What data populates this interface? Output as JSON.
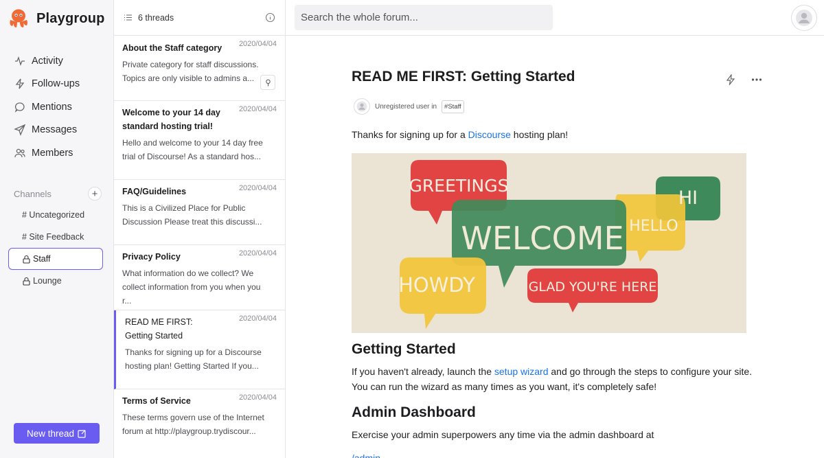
{
  "brand": {
    "name": "Playgroup",
    "logo_icon": "octopus-logo-icon",
    "logo_color": "#f06a35"
  },
  "nav": [
    {
      "label": "Activity",
      "icon": "activity-icon"
    },
    {
      "label": "Follow-ups",
      "icon": "lightning-icon"
    },
    {
      "label": "Mentions",
      "icon": "chat-bubble-icon"
    },
    {
      "label": "Messages",
      "icon": "send-icon"
    },
    {
      "label": "Members",
      "icon": "members-icon"
    }
  ],
  "channels": {
    "label": "Channels",
    "add_label": "+",
    "items": [
      {
        "label": "# Uncategorized",
        "locked": false
      },
      {
        "label": "# Site Feedback",
        "locked": false
      },
      {
        "label": "Staff",
        "locked": true,
        "active": true
      },
      {
        "label": "Lounge",
        "locked": true
      }
    ]
  },
  "new_thread": {
    "label": "New thread",
    "icon": "compose-icon"
  },
  "threads": {
    "count_label": "6 threads",
    "items": [
      {
        "title": "About the Staff category",
        "date": "2020/04/04",
        "excerpt": "Private category for staff discussions.\nTopics are only visible to admins a...",
        "pinned": true
      },
      {
        "title": "Welcome to your 14 day standard hosting trial!",
        "date": "2020/04/04",
        "excerpt": "Hello and welcome to your 14 day free\ntrial of Discourse! As a standard hos..."
      },
      {
        "title": "FAQ/Guidelines",
        "date": "2020/04/04",
        "excerpt": "This is a Civilized Place for Public\nDiscussion Please treat this discussi..."
      },
      {
        "title": "Privacy Policy",
        "date": "2020/04/04",
        "excerpt": "What information do we collect? We\ncollect information from you when you r..."
      },
      {
        "title": "READ ME FIRST: Getting Started",
        "date": "2020/04/04",
        "excerpt": "Thanks for signing up for a Discourse\nhosting plan! Getting Started If you...",
        "active": true
      },
      {
        "title": "Terms of Service",
        "date": "2020/04/04",
        "excerpt": "These terms govern use of the Internet\nforum at http://playgroup.trydiscour..."
      }
    ]
  },
  "search": {
    "placeholder": "Search the whole forum..."
  },
  "post": {
    "title": "READ ME FIRST: Getting Started",
    "author": "Unregistered user in",
    "tag": "#Staff",
    "intro_before": "Thanks for signing up for a ",
    "intro_link": "Discourse",
    "intro_after": " hosting plan!",
    "banner": {
      "greetings": "GREETINGS",
      "welcome": "WELCOME",
      "hello": "HELLO",
      "hi": "HI",
      "howdy": "HOWDY",
      "glad": "GLAD YOU'RE HERE"
    },
    "h_getting_started": "Getting Started",
    "gs_line1_before": "If you haven't already, launch the ",
    "gs_link": "setup wizard",
    "gs_line1_after": " and go through the steps to configure your site.",
    "gs_line2": "You can run the wizard as many times as you want, it's completely safe!",
    "h_admin": "Admin Dashboard",
    "admin_line": "Exercise your admin superpowers any time via the admin dashboard at",
    "admin_link": "/admin"
  },
  "colors": {
    "accent": "#6a5cf0",
    "link": "#1a73e8",
    "red": "#e53a3a",
    "green": "#3d8b5a",
    "yellow": "#f2c53d"
  }
}
